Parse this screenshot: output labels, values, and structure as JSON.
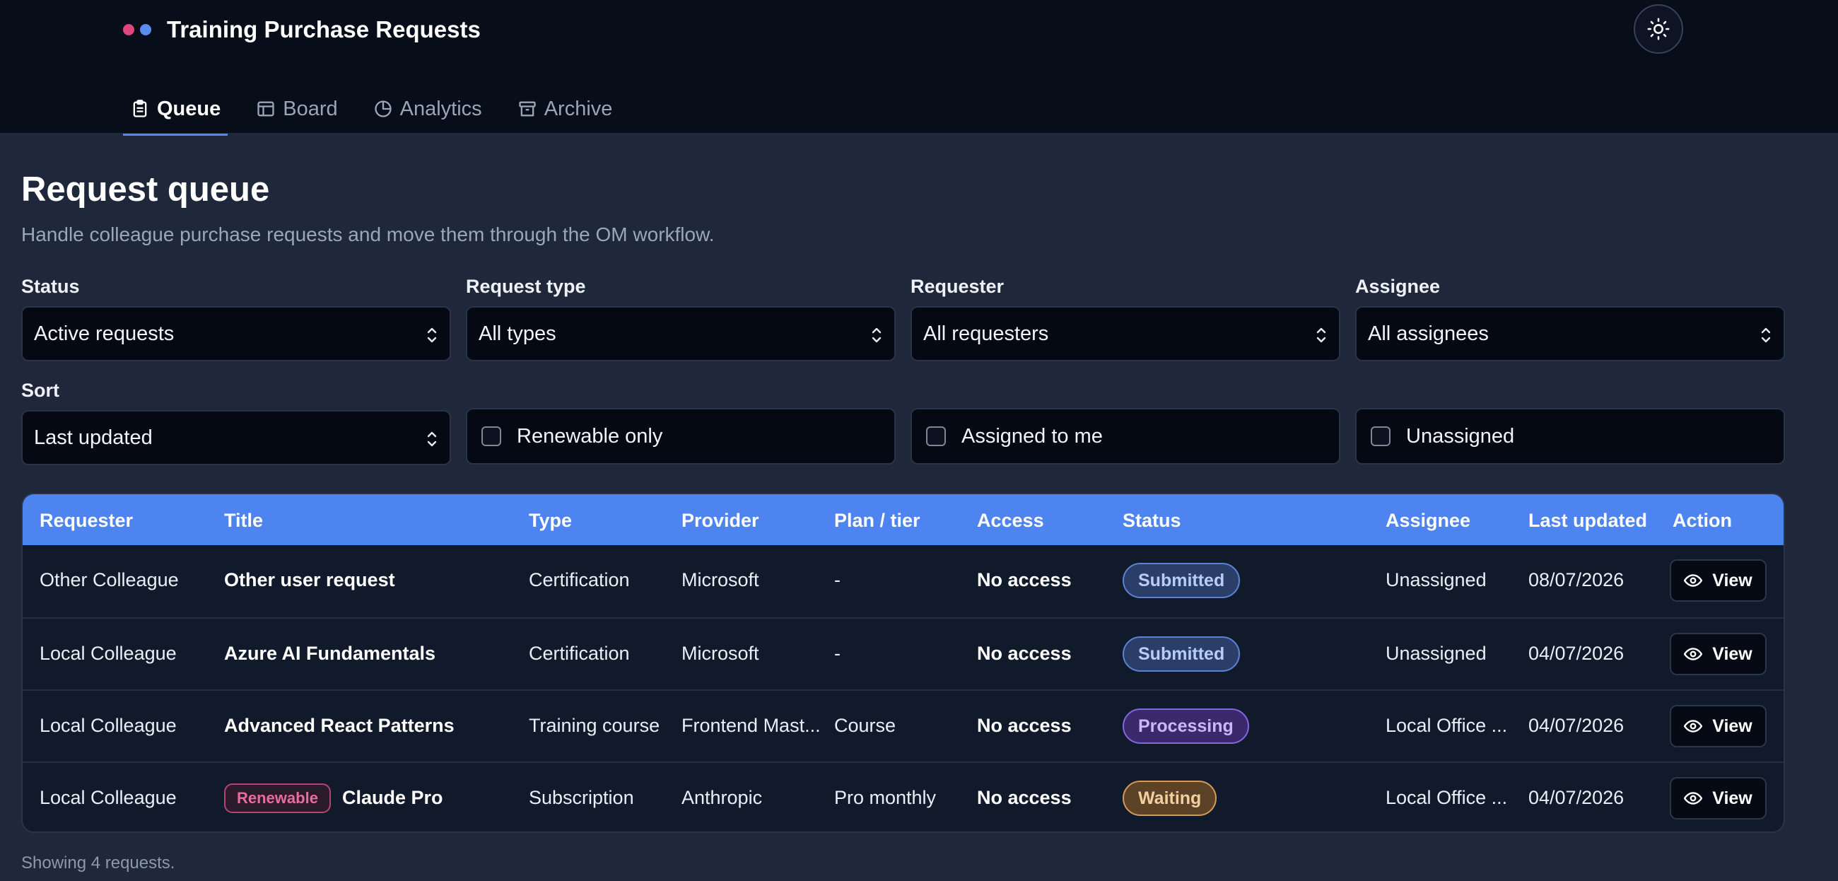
{
  "header": {
    "title": "Training Purchase Requests",
    "brand_colors": [
      "#e0467c",
      "#5b8def"
    ],
    "theme_toggle_icon": "sun-icon"
  },
  "nav": {
    "tabs": [
      {
        "label": "Queue",
        "icon": "clipboard-icon",
        "active": true
      },
      {
        "label": "Board",
        "icon": "board-icon",
        "active": false
      },
      {
        "label": "Analytics",
        "icon": "pie-chart-icon",
        "active": false
      },
      {
        "label": "Archive",
        "icon": "archive-icon",
        "active": false
      }
    ]
  },
  "main": {
    "title": "Request queue",
    "subtitle": "Handle colleague purchase requests and move them through the OM workflow."
  },
  "filters": {
    "status": {
      "label": "Status",
      "value": "Active requests"
    },
    "request_type": {
      "label": "Request type",
      "value": "All types"
    },
    "requester": {
      "label": "Requester",
      "value": "All requesters"
    },
    "assignee": {
      "label": "Assignee",
      "value": "All assignees"
    },
    "sort": {
      "label": "Sort",
      "value": "Last updated"
    },
    "renewable_only": {
      "label": "Renewable only",
      "checked": false
    },
    "assigned_to_me": {
      "label": "Assigned to me",
      "checked": false
    },
    "unassigned": {
      "label": "Unassigned",
      "checked": false
    }
  },
  "table": {
    "columns": [
      "Requester",
      "Title",
      "Type",
      "Provider",
      "Plan / tier",
      "Access",
      "Status",
      "Assignee",
      "Last updated",
      "Action"
    ],
    "rows": [
      {
        "requester": "Other Colleague",
        "title": "Other user request",
        "renewable": "",
        "type": "Certification",
        "provider": "Microsoft",
        "plan": "-",
        "access": "No access",
        "status": "Submitted",
        "status_kind": "submitted",
        "assignee": "Unassigned",
        "updated": "08/07/2026",
        "action": "View"
      },
      {
        "requester": "Local Colleague",
        "title": "Azure AI Fundamentals",
        "renewable": "",
        "type": "Certification",
        "provider": "Microsoft",
        "plan": "-",
        "access": "No access",
        "status": "Submitted",
        "status_kind": "submitted",
        "assignee": "Unassigned",
        "updated": "04/07/2026",
        "action": "View"
      },
      {
        "requester": "Local Colleague",
        "title": "Advanced React Patterns",
        "renewable": "",
        "type": "Training course",
        "provider": "Frontend Mast...",
        "plan": "Course",
        "access": "No access",
        "status": "Processing",
        "status_kind": "processing",
        "assignee": "Local Office ...",
        "updated": "04/07/2026",
        "action": "View"
      },
      {
        "requester": "Local Colleague",
        "title": "Claude Pro",
        "renewable": "Renewable",
        "type": "Subscription",
        "provider": "Anthropic",
        "plan": "Pro monthly",
        "access": "No access",
        "status": "Waiting",
        "status_kind": "waiting",
        "assignee": "Local Office ...",
        "updated": "04/07/2026",
        "action": "View"
      }
    ],
    "footer": "Showing 4 requests."
  }
}
